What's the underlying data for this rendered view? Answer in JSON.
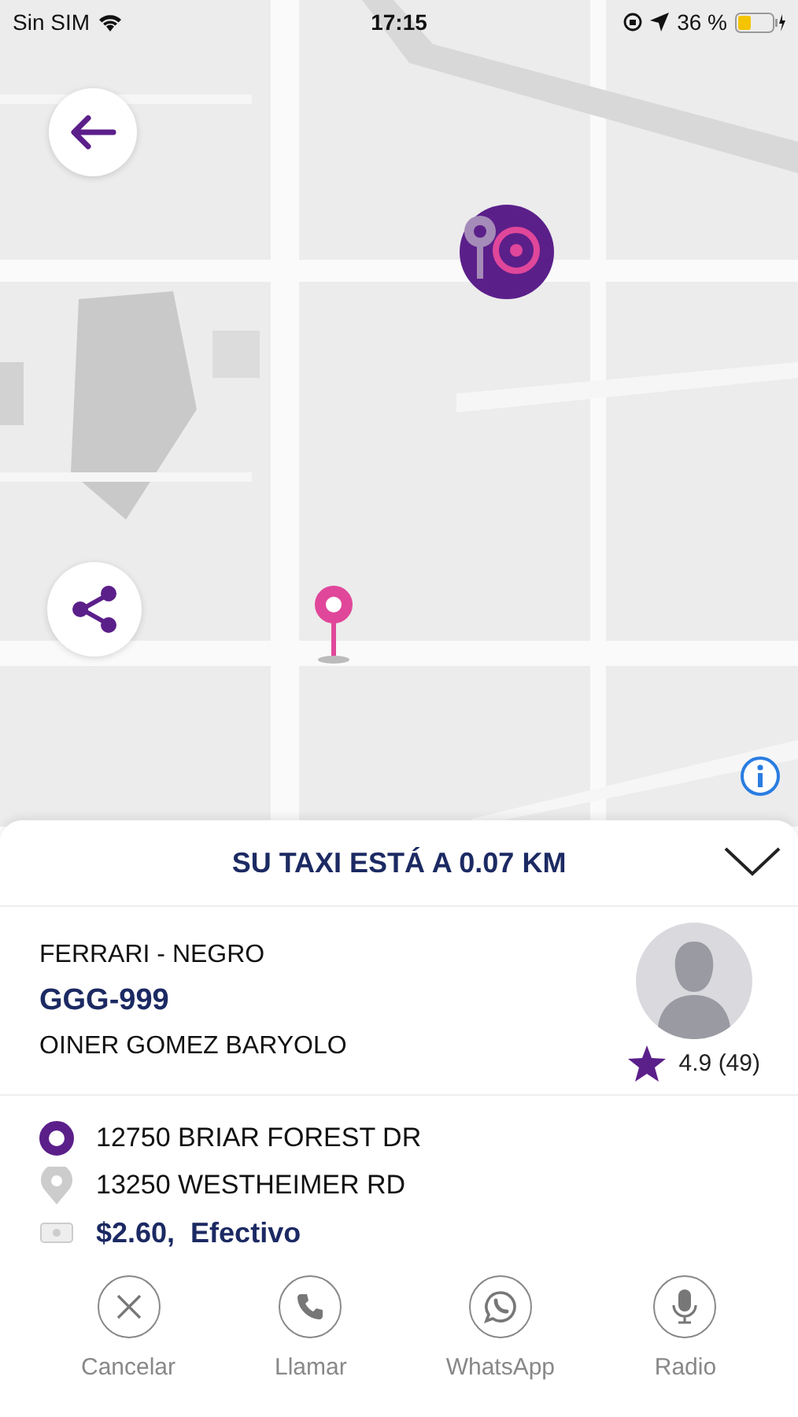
{
  "status_bar": {
    "carrier": "Sin SIM",
    "time": "17:15",
    "battery": "36 %"
  },
  "sheet": {
    "title": "SU TAXI ESTÁ A 0.07 KM"
  },
  "driver": {
    "car": "FERRARI - NEGRO",
    "plate": "GGG-999",
    "name": "OINER GOMEZ BARYOLO",
    "rating": "4.9 (49)"
  },
  "trip": [
    {
      "kind": "origin",
      "text": "12750 BRIAR FOREST DR"
    },
    {
      "kind": "destination",
      "text": "13250 WESTHEIMER RD"
    },
    {
      "kind": "payment",
      "text": "$2.60,  Efectivo"
    }
  ],
  "actions": [
    {
      "kind": "cancel",
      "label": "Cancelar"
    },
    {
      "kind": "call",
      "label": "Llamar"
    },
    {
      "kind": "whatsapp",
      "label": "WhatsApp"
    },
    {
      "kind": "radio",
      "label": "Radio"
    }
  ]
}
